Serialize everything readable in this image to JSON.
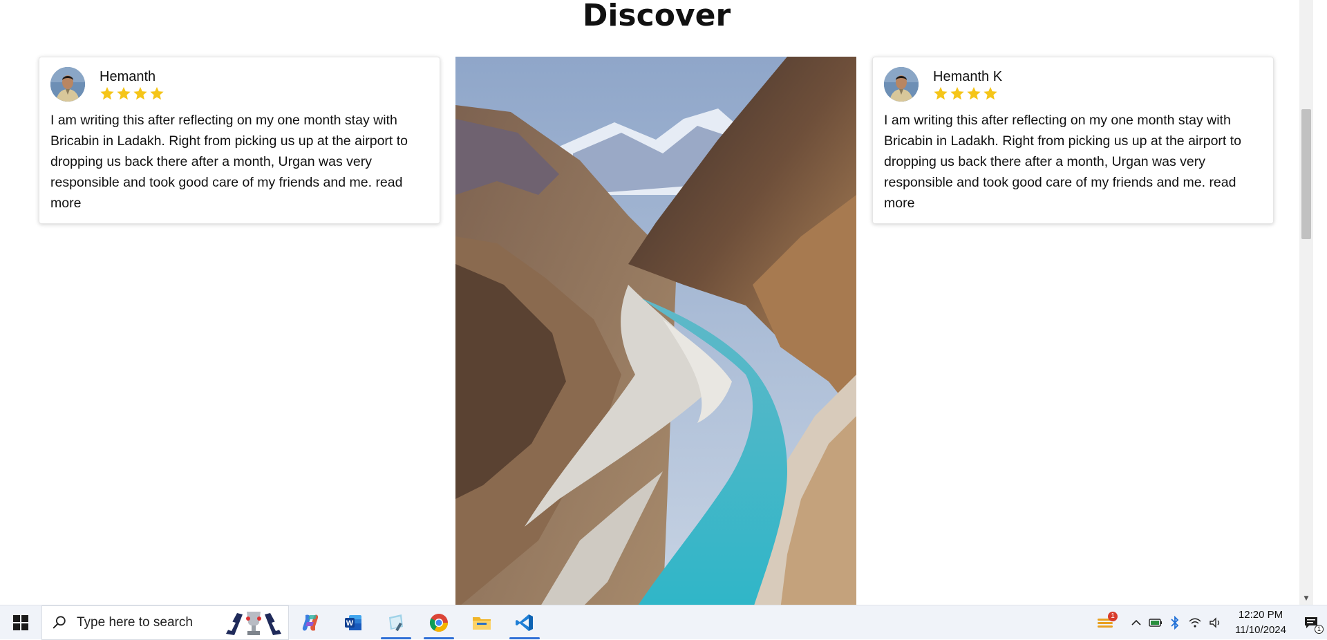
{
  "page": {
    "title": "Discover"
  },
  "reviews": [
    {
      "name": "Hemanth",
      "rating": 4,
      "text": "I am writing this after reflecting on my one month stay with Bricabin in Ladakh. Right from picking us up at the airport to dropping us back there after a month, Urgan was very responsible and took good care of my friends and me. ",
      "read_more": "read more"
    },
    {
      "name": "Hemanth K",
      "rating": 4,
      "text": "I am writing this after reflecting on my one month stay with Bricabin in Ladakh. Right from picking us up at the airport to dropping us back there after a month, Urgan was very responsible and took good care of my friends and me. ",
      "read_more": "read more"
    }
  ],
  "colors": {
    "star": "#f5c518",
    "accent": "#2f6fd6"
  },
  "taskbar": {
    "search_placeholder": "Type here to search",
    "apps": [
      "copilot-icon",
      "word-icon",
      "notepad-icon",
      "chrome-icon",
      "file-explorer-icon",
      "vscode-icon"
    ],
    "notification_badge": "1",
    "time": "12:20 PM",
    "date": "11/10/2024",
    "notification_count": "1"
  }
}
